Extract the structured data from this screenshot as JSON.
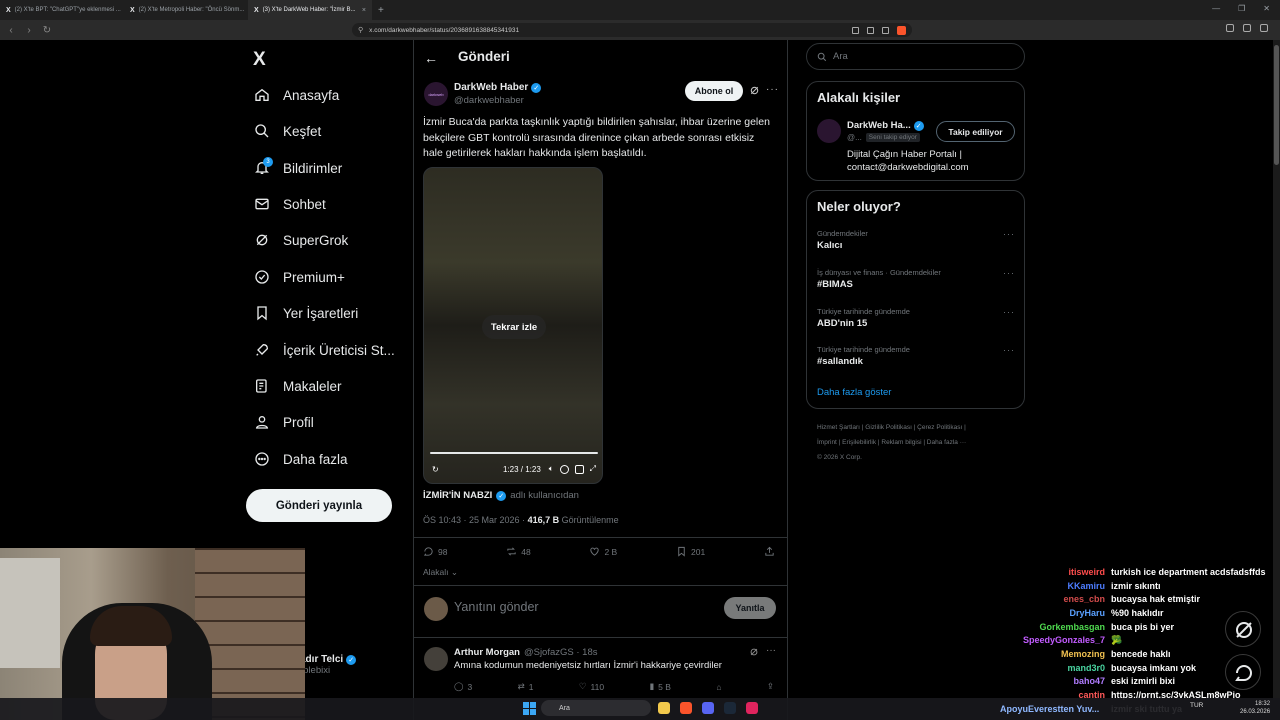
{
  "browser": {
    "tabs": [
      {
        "label": "(2) X'te BPT: \"ChatGPT\"ye eklenmesi ..."
      },
      {
        "label": "(2) X'te Metropoli Haber: \"Öncü Sönm..."
      },
      {
        "label": "(3) X'te DarkWeb Haber: \"İzmir B..."
      }
    ],
    "url": "x.com/darkwebhaber/status/2036891638845341931"
  },
  "nav": {
    "logo": "X",
    "items": [
      {
        "label": "Anasayfa",
        "icon": "home-icon"
      },
      {
        "label": "Keşfet",
        "icon": "search-icon"
      },
      {
        "label": "Bildirimler",
        "icon": "bell-icon",
        "badge": "3"
      },
      {
        "label": "Sohbet",
        "icon": "mail-icon"
      },
      {
        "label": "SuperGrok",
        "icon": "grok-icon"
      },
      {
        "label": "Premium+",
        "icon": "premium-icon"
      },
      {
        "label": "Yer İşaretleri",
        "icon": "bookmark-icon"
      },
      {
        "label": "İçerik Üreticisi St...",
        "icon": "rocket-icon"
      },
      {
        "label": "Makaleler",
        "icon": "article-icon"
      },
      {
        "label": "Profil",
        "icon": "person-icon"
      },
      {
        "label": "Daha fazla",
        "icon": "more-circle-icon"
      }
    ],
    "post_button": "Gönderi yayınla",
    "account": {
      "name": "adır Telci",
      "handle": "rplebixi"
    }
  },
  "post": {
    "header_title": "Gönderi",
    "author": {
      "name": "DarkWeb Haber",
      "handle": "@darkwebhaber",
      "avatar_text": "darkweb"
    },
    "subscribe_button": "Abone ol",
    "text": "İzmir Buca'da parkta taşkınlık yaptığı bildirilen şahıslar, ihbar üzerine gelen bekçilere GBT kontrolü sırasında direnince çıkan arbede sonrası etkisiz hale getirilerek hakları hakkında işlem başlatıldı.",
    "video": {
      "replay_label": "Tekrar izle",
      "time": "1:23 / 1:23",
      "progress": 1.0
    },
    "attribution": {
      "source": "İZMİR'İN NABZI",
      "suffix": "adlı kullanıcıdan"
    },
    "meta": {
      "time": "ÖS 10:43 · 25 Mar 2026 ·",
      "views": "416,7 B",
      "views_label": "Görüntülenme"
    },
    "stats": {
      "replies": "98",
      "reposts": "48",
      "likes": "2 B",
      "bookmarks": "201"
    },
    "sort_label": "Alakalı",
    "reply_placeholder": "Yanıtını gönder",
    "reply_button": "Yanıtla"
  },
  "reply": {
    "name": "Arthur Morgan",
    "handle": "@SjofazGS · 18s",
    "text": "Amına kodumun medeniyetsiz hırtları İzmir'i hakkariye çevirdiler",
    "stats": {
      "replies": "3",
      "reposts": "1",
      "likes": "110",
      "views": "5 B"
    }
  },
  "sidebar": {
    "search_placeholder": "Ara",
    "related_title": "Alakalı kişiler",
    "related_person": {
      "name": "DarkWeb Ha...",
      "handle": "@...",
      "follows_you": "Seni takip ediyor",
      "button": "Takip ediliyor",
      "bio": "Dijital Çağın Haber Portalı | contact@darkwebdigital.com"
    },
    "trends_title": "Neler oluyor?",
    "trends": [
      {
        "category": "Gündemdekiler",
        "name": "Kalıcı"
      },
      {
        "category": "İş dünyası ve finans · Gündemdekiler",
        "name": "#BIMAS"
      },
      {
        "category": "Türkiye tarihinde gündemde",
        "name": "ABD'nin 15"
      },
      {
        "category": "Türkiye tarihinde gündemde",
        "name": "#sallandık"
      }
    ],
    "show_more": "Daha fazla göster",
    "footer_line1": "Hizmet Şartları  |  Gizlilik Politikası  |  Çerez Politikası  |",
    "footer_line2": "İmprint  |  Erişilebilirlik  |  Reklam bilgisi  |  Daha fazla ···",
    "footer_line3": "© 2026 X Corp."
  },
  "chat": [
    {
      "user": "itisweird",
      "color": "#ff4d4d",
      "msg": "turkish ice department acdsfadsffds"
    },
    {
      "user": "KKamiru",
      "color": "#4d7dff",
      "msg": "izmir sıkıntı"
    },
    {
      "user": "enes_cbn",
      "color": "#d14b4b",
      "msg": "bucaysa hak etmiştir"
    },
    {
      "user": "DryHaru",
      "color": "#5aa0ff",
      "msg": "%90 haklıdır"
    },
    {
      "user": "Gorkembasgan",
      "color": "#4fd94f",
      "msg": "buca pis bi yer"
    },
    {
      "user": "SpeedyGonzales_7",
      "color": "#c25cff",
      "msg": "🥦"
    },
    {
      "user": "Memozing",
      "color": "#f0c050",
      "msg": "bencede haklı"
    },
    {
      "user": "mand3r0",
      "color": "#49d3a0",
      "msg": "bucaysa imkanı yok"
    },
    {
      "user": "baho47",
      "color": "#b07cff",
      "msg": "eski izmirli bixi"
    },
    {
      "user": "cantin",
      "color": "#ff5a5a",
      "msg": "https://prnt.sc/3vkASLm8wPjo"
    },
    {
      "user": "",
      "color": "#ffffff",
      "msg": "izmir ski tuttu ya"
    }
  ],
  "taskbar": {
    "search": "Ara",
    "marquee": "ApoyuEverestten Yuv...",
    "lang": "TUR",
    "time": "18:32",
    "date": "26.03.2026"
  },
  "colors": {
    "accent": "#1d9bf0",
    "background": "#000000",
    "border": "#2f3336",
    "muted": "#71767b"
  }
}
